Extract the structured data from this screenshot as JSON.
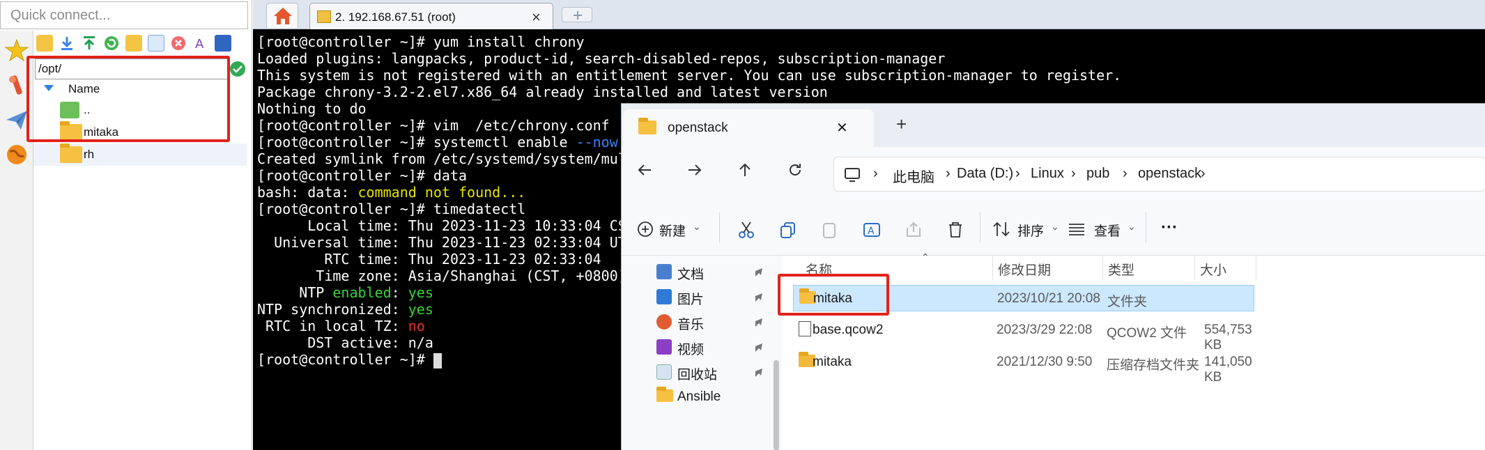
{
  "left_panel": {
    "quick_connect_placeholder": "Quick connect...",
    "path": "/opt/",
    "tree_header": "Name",
    "items": [
      {
        "name": ".."
      },
      {
        "name": "mitaka"
      },
      {
        "name": "rh"
      }
    ]
  },
  "tabs": {
    "ssh_tab_label": "2. 192.168.67.51 (root)",
    "close_glyph": "×"
  },
  "terminal": {
    "lines": [
      {
        "parts": [
          {
            "t": "[root@controller ~]# yum install chrony",
            "c": ""
          }
        ]
      },
      {
        "parts": [
          {
            "t": "Loaded plugins: langpacks, product-id, search-disabled-repos, subscription-manager",
            "c": ""
          }
        ]
      },
      {
        "parts": [
          {
            "t": "This system is not registered with an entitlement server. You can use subscription-manager to register.",
            "c": ""
          }
        ]
      },
      {
        "parts": [
          {
            "t": "Package chrony-3.2-2.el7.x86_64 already installed and latest version",
            "c": ""
          }
        ]
      },
      {
        "parts": [
          {
            "t": "Nothing to do",
            "c": ""
          }
        ]
      },
      {
        "parts": [
          {
            "t": "[root@controller ~]# vim  /etc/chrony.conf",
            "c": ""
          }
        ]
      },
      {
        "parts": [
          {
            "t": "[root@controller ~]# systemctl enable ",
            "c": ""
          },
          {
            "t": "--now",
            "c": "b"
          }
        ]
      },
      {
        "parts": [
          {
            "t": "Created symlink from /etc/systemd/system/mul",
            "c": ""
          }
        ]
      },
      {
        "parts": [
          {
            "t": "[root@controller ~]# data",
            "c": ""
          }
        ]
      },
      {
        "parts": [
          {
            "t": "bash: data: ",
            "c": ""
          },
          {
            "t": "command not found...",
            "c": "y"
          }
        ]
      },
      {
        "parts": [
          {
            "t": "[root@controller ~]# timedatectl",
            "c": ""
          }
        ]
      },
      {
        "parts": [
          {
            "t": "      Local time: Thu 2023-11-23 10:33:04 CS",
            "c": ""
          }
        ]
      },
      {
        "parts": [
          {
            "t": "  Universal time: Thu 2023-11-23 02:33:04 UT",
            "c": ""
          }
        ]
      },
      {
        "parts": [
          {
            "t": "        RTC time: Thu 2023-11-23 02:33:04",
            "c": ""
          }
        ]
      },
      {
        "parts": [
          {
            "t": "       Time zone: Asia/Shanghai (CST, +0800)",
            "c": ""
          }
        ]
      },
      {
        "parts": [
          {
            "t": "     NTP ",
            "c": ""
          },
          {
            "t": "enabled",
            "c": "g"
          },
          {
            "t": ": ",
            "c": ""
          },
          {
            "t": "yes",
            "c": "g"
          }
        ]
      },
      {
        "parts": [
          {
            "t": "NTP synchronized: ",
            "c": ""
          },
          {
            "t": "yes",
            "c": "g"
          }
        ]
      },
      {
        "parts": [
          {
            "t": " RTC in local TZ: ",
            "c": ""
          },
          {
            "t": "no",
            "c": "r"
          }
        ]
      },
      {
        "parts": [
          {
            "t": "      DST active: n/a",
            "c": ""
          }
        ]
      },
      {
        "parts": [
          {
            "t": "[root@controller ~]# ",
            "c": ""
          }
        ]
      }
    ]
  },
  "explorer": {
    "tab_title": "openstack",
    "close_glyph": "✕",
    "new_tab_glyph": "+",
    "breadcrumb": [
      "此电脑",
      "Data (D:)",
      "Linux",
      "pub",
      "openstack"
    ],
    "commands": {
      "new_label": "新建",
      "sort_label": "排序",
      "view_label": "查看",
      "more_label": "···"
    },
    "nav_items": [
      "文档",
      "图片",
      "音乐",
      "视频",
      "回收站",
      "Ansible"
    ],
    "columns": [
      "名称",
      "修改日期",
      "类型",
      "大小"
    ],
    "rows": [
      {
        "name": "mitaka",
        "date": "2023/10/21 20:08",
        "type": "文件夹",
        "size": "",
        "selected": true
      },
      {
        "name": "base.qcow2",
        "date": "2023/3/29 22:08",
        "type": "QCOW2 文件",
        "size": "554,753 KB"
      },
      {
        "name": "mitaka",
        "date": "2021/12/30 9:50",
        "type": "压缩存档文件夹",
        "size": "141,050 KB"
      }
    ]
  },
  "colors": {
    "terminal_bg": "#000000",
    "highlight_red": "#e2231a",
    "folder_yellow": "#f6c041",
    "selection_blue": "#cce8ff"
  }
}
